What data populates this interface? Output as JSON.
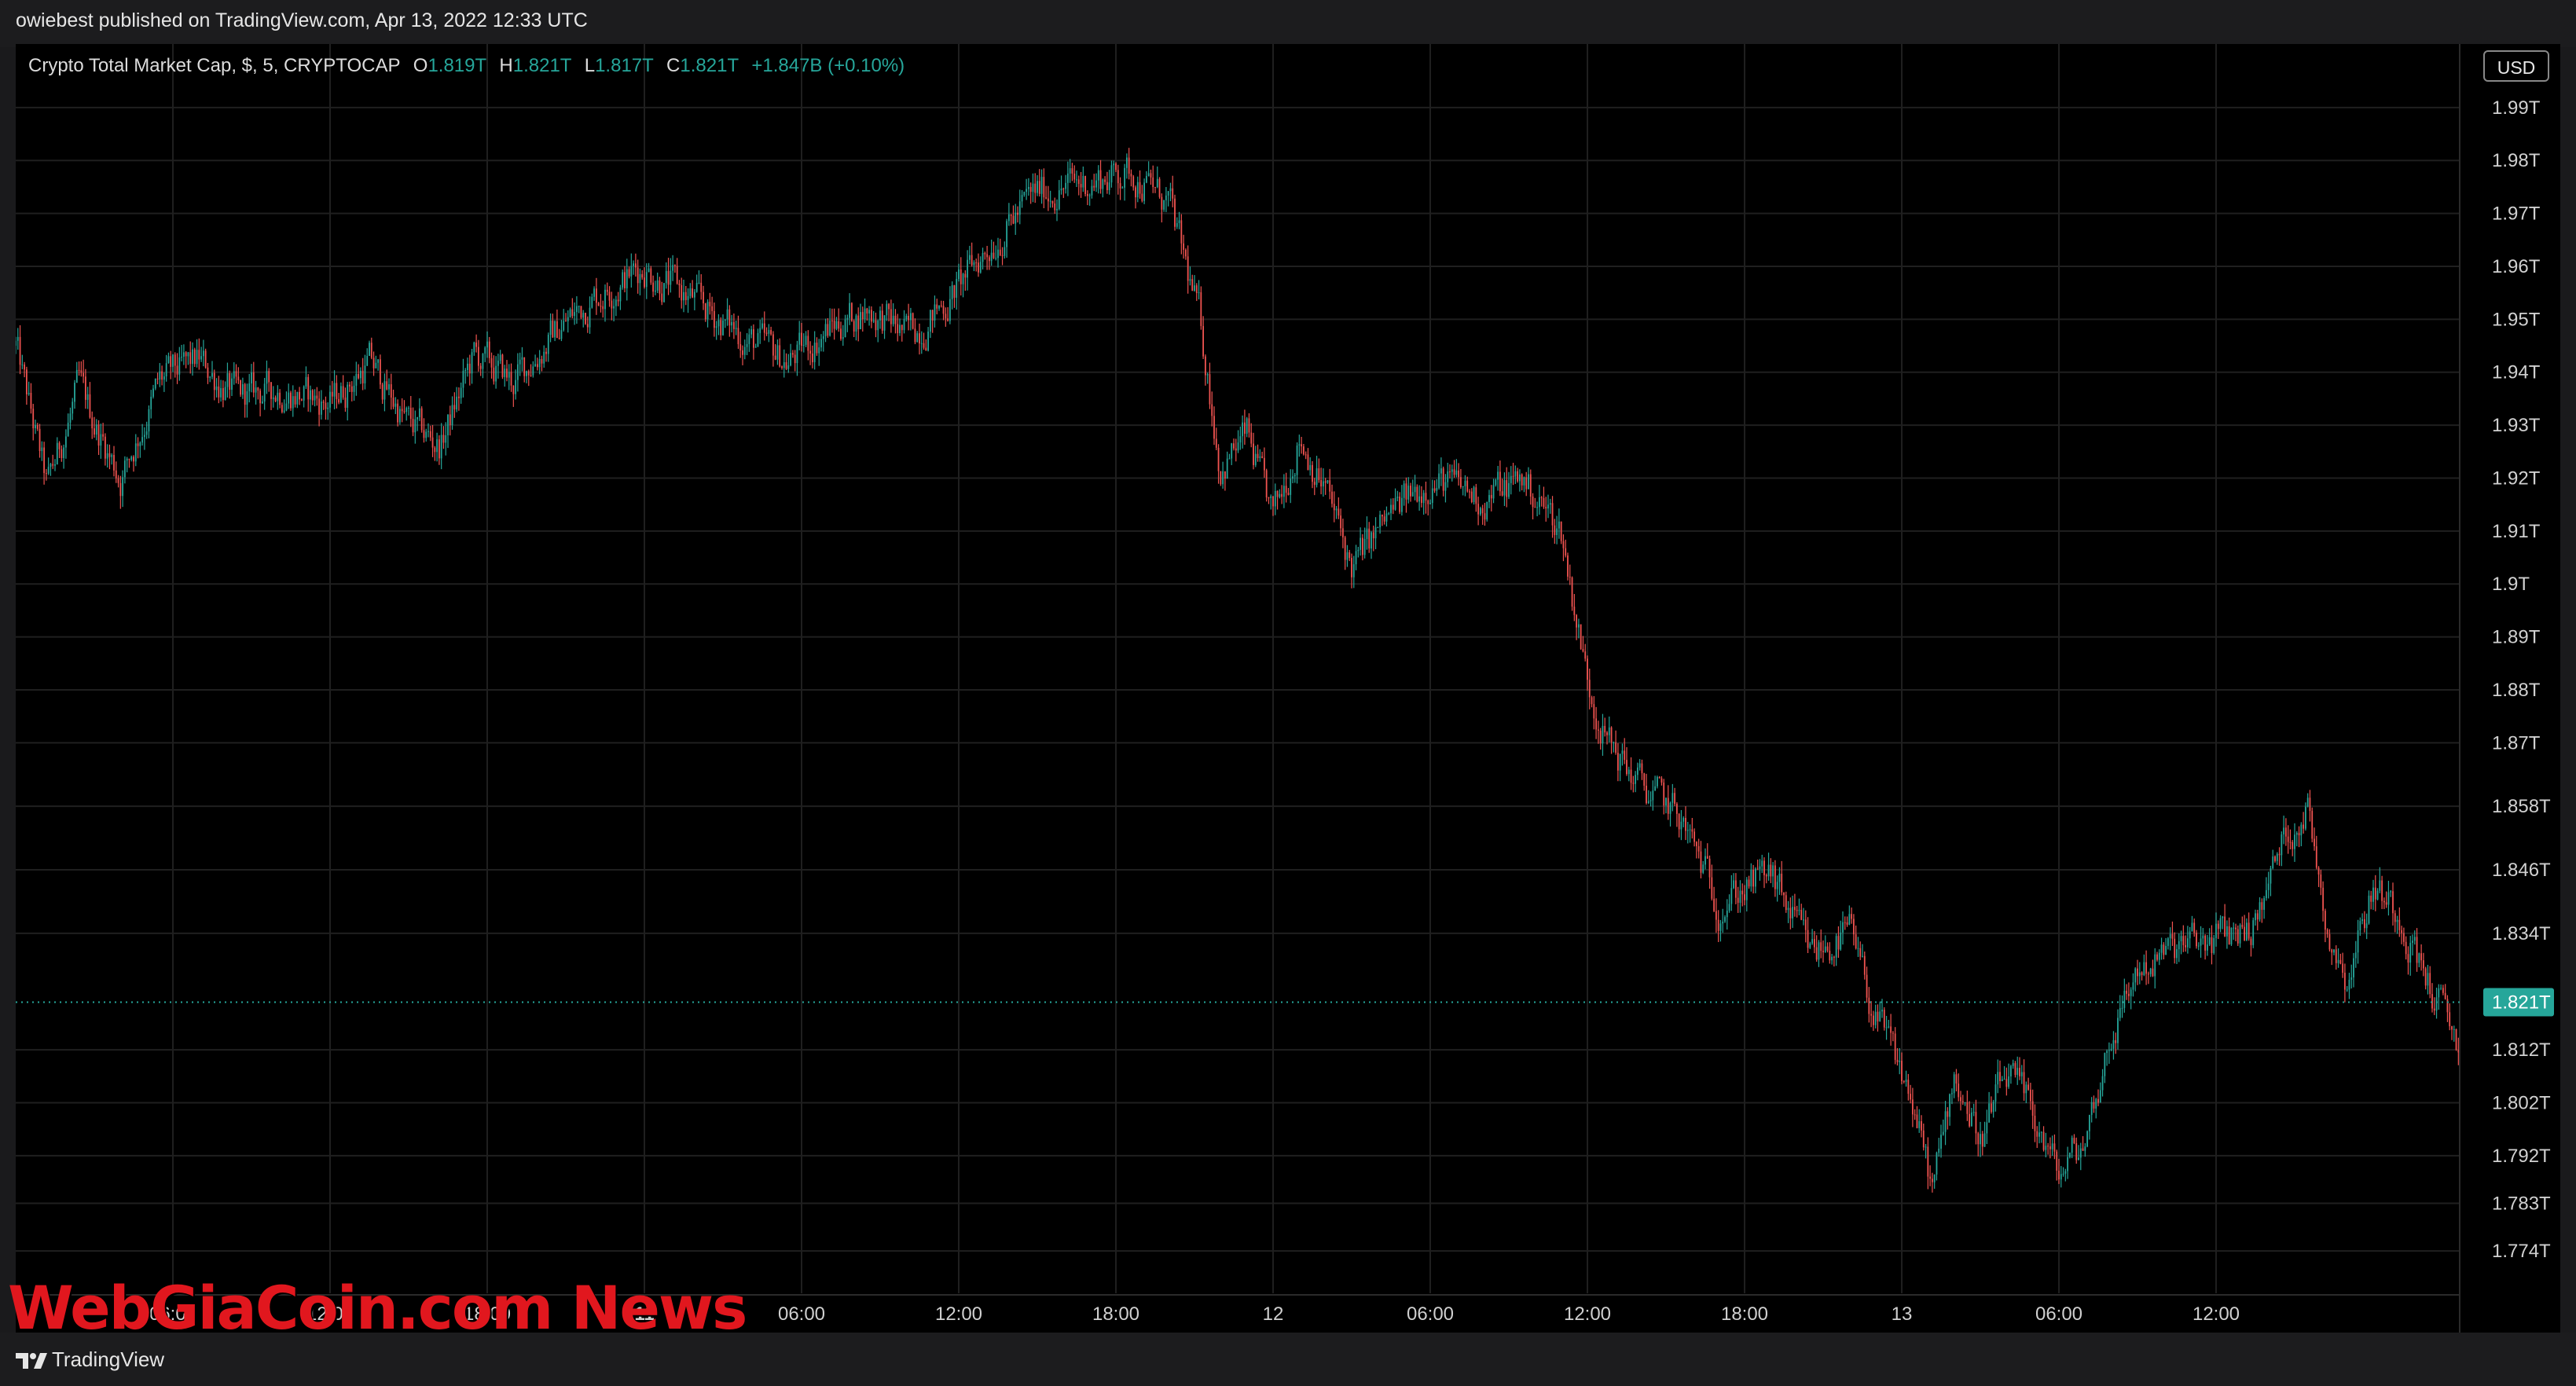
{
  "publisher": "owiebest published on TradingView.com, Apr 13, 2022 12:33 UTC",
  "legend": {
    "symbol": "Crypto Total Market Cap, $, 5, CRYPTOCAP",
    "o_label": "O",
    "o_value": "1.819T",
    "h_label": "H",
    "h_value": "1.821T",
    "l_label": "L",
    "l_value": "1.817T",
    "c_label": "C",
    "c_value": "1.821T",
    "change": "+1.847B (+0.10%)"
  },
  "currency_button": "USD",
  "footer": {
    "logo_text": "TradingView"
  },
  "watermark": "WebGiaCoin.com News",
  "colors": {
    "background": "#000000",
    "up": "#26a69a",
    "down": "#ef5350",
    "grid": "#1f1f1f",
    "last_price_badge": "#26a69a",
    "watermark": "#e1171e"
  },
  "icons": {
    "logo": "tradingview-logo-icon"
  },
  "chart_data": {
    "type": "candlestick",
    "symbol": "CRYPTOCAP:TOTAL",
    "interval": "5",
    "y_unit": "T USD",
    "ylim": [
      1.766,
      2.002
    ],
    "y_ticks": [
      {
        "value": 1.99,
        "label": "1.99T"
      },
      {
        "value": 1.98,
        "label": "1.98T"
      },
      {
        "value": 1.97,
        "label": "1.97T"
      },
      {
        "value": 1.96,
        "label": "1.96T"
      },
      {
        "value": 1.95,
        "label": "1.95T"
      },
      {
        "value": 1.94,
        "label": "1.94T"
      },
      {
        "value": 1.93,
        "label": "1.93T"
      },
      {
        "value": 1.92,
        "label": "1.92T"
      },
      {
        "value": 1.91,
        "label": "1.91T"
      },
      {
        "value": 1.9,
        "label": "1.9T"
      },
      {
        "value": 1.89,
        "label": "1.89T"
      },
      {
        "value": 1.88,
        "label": "1.88T"
      },
      {
        "value": 1.87,
        "label": "1.87T"
      },
      {
        "value": 1.858,
        "label": "1.858T"
      },
      {
        "value": 1.846,
        "label": "1.846T"
      },
      {
        "value": 1.834,
        "label": "1.834T"
      },
      {
        "value": 1.812,
        "label": "1.812T"
      },
      {
        "value": 1.802,
        "label": "1.802T"
      },
      {
        "value": 1.792,
        "label": "1.792T"
      },
      {
        "value": 1.783,
        "label": "1.783T"
      },
      {
        "value": 1.774,
        "label": "1.774T"
      }
    ],
    "last_price": {
      "value": 1.821,
      "label": "1.821T"
    },
    "x_range_hours": [
      0,
      93.3
    ],
    "x_ticks": [
      {
        "hour": 6,
        "label": "06:00",
        "bold": false
      },
      {
        "hour": 12,
        "label": "12:00",
        "bold": false
      },
      {
        "hour": 18,
        "label": "18:00",
        "bold": false
      },
      {
        "hour": 24,
        "label": "11",
        "bold": true
      },
      {
        "hour": 30,
        "label": "06:00",
        "bold": false
      },
      {
        "hour": 36,
        "label": "12:00",
        "bold": false
      },
      {
        "hour": 42,
        "label": "18:00",
        "bold": false
      },
      {
        "hour": 48,
        "label": "12",
        "bold": false
      },
      {
        "hour": 54,
        "label": "06:00",
        "bold": false
      },
      {
        "hour": 60,
        "label": "12:00",
        "bold": false
      },
      {
        "hour": 66,
        "label": "18:00",
        "bold": false
      },
      {
        "hour": 72,
        "label": "13",
        "bold": false
      },
      {
        "hour": 78,
        "label": "06:00",
        "bold": false
      },
      {
        "hour": 84,
        "label": "12:00",
        "bold": false
      }
    ],
    "price_path": [
      [
        0.0,
        1.945
      ],
      [
        1.2,
        1.918
      ],
      [
        2.4,
        1.937
      ],
      [
        4.0,
        1.92
      ],
      [
        5.5,
        1.938
      ],
      [
        7.0,
        1.942
      ],
      [
        8.5,
        1.935
      ],
      [
        10.0,
        1.937
      ],
      [
        12.0,
        1.934
      ],
      [
        13.5,
        1.942
      ],
      [
        15.0,
        1.93
      ],
      [
        16.2,
        1.926
      ],
      [
        17.5,
        1.943
      ],
      [
        19.0,
        1.938
      ],
      [
        20.5,
        1.947
      ],
      [
        22.0,
        1.954
      ],
      [
        24.0,
        1.96
      ],
      [
        26.0,
        1.953
      ],
      [
        28.0,
        1.946
      ],
      [
        29.5,
        1.942
      ],
      [
        31.0,
        1.948
      ],
      [
        32.5,
        1.952
      ],
      [
        34.0,
        1.947
      ],
      [
        35.5,
        1.953
      ],
      [
        37.5,
        1.966
      ],
      [
        39.0,
        1.974
      ],
      [
        41.0,
        1.976
      ],
      [
        42.6,
        1.978
      ],
      [
        44.0,
        1.972
      ],
      [
        45.2,
        1.95
      ],
      [
        46.0,
        1.922
      ],
      [
        47.0,
        1.928
      ],
      [
        48.0,
        1.912
      ],
      [
        49.0,
        1.928
      ],
      [
        50.0,
        1.918
      ],
      [
        51.0,
        1.903
      ],
      [
        52.5,
        1.913
      ],
      [
        54.0,
        1.92
      ],
      [
        56.0,
        1.916
      ],
      [
        57.5,
        1.92
      ],
      [
        59.0,
        1.91
      ],
      [
        60.0,
        1.882
      ],
      [
        60.8,
        1.87
      ],
      [
        62.0,
        1.862
      ],
      [
        63.5,
        1.856
      ],
      [
        65.0,
        1.84
      ],
      [
        67.0,
        1.845
      ],
      [
        68.5,
        1.83
      ],
      [
        70.0,
        1.834
      ],
      [
        71.0,
        1.818
      ],
      [
        72.3,
        1.804
      ],
      [
        73.2,
        1.785
      ],
      [
        74.0,
        1.808
      ],
      [
        75.0,
        1.795
      ],
      [
        76.0,
        1.807
      ],
      [
        77.0,
        1.8
      ],
      [
        78.0,
        1.788
      ],
      [
        79.0,
        1.795
      ],
      [
        80.0,
        1.815
      ],
      [
        81.0,
        1.827
      ],
      [
        82.5,
        1.831
      ],
      [
        84.0,
        1.833
      ],
      [
        85.5,
        1.836
      ],
      [
        86.6,
        1.852
      ],
      [
        87.5,
        1.858
      ],
      [
        88.3,
        1.834
      ],
      [
        89.0,
        1.826
      ],
      [
        90.0,
        1.843
      ],
      [
        91.0,
        1.838
      ],
      [
        92.0,
        1.826
      ],
      [
        93.3,
        1.812
      ]
    ],
    "price_path_note": "approximate close-price path (hour since chart start, value in T USD); used to generate 5-minute candles",
    "grid": true,
    "legend_placement": "top-left"
  }
}
